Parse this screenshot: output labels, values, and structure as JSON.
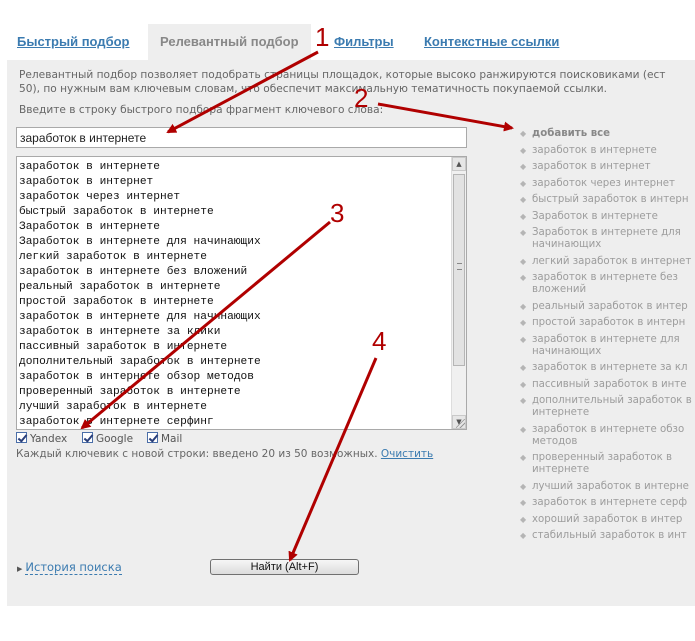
{
  "tabs": [
    {
      "label": "Быстрый подбор",
      "active": false
    },
    {
      "label": "Релевантный подбор",
      "active": true
    },
    {
      "label": "Фильтры",
      "active": false
    },
    {
      "label": "Контекстные ссылки",
      "active": false
    }
  ],
  "description": {
    "line1": "Релевантный подбор позволяет подобрать страницы площадок, которые высоко ранжируются поисковиками (ест",
    "line2": "50), по нужным вам ключевым словам, что обеспечит максимальную тематичность покупаемой ссылки."
  },
  "hint": "Введите в строку быстрого подбора фрагмент ключевого слова:",
  "query": {
    "value": "заработок в интернете"
  },
  "keywords": [
    "заработок в интернете",
    "заработок в интернет",
    "заработок через интернет",
    "быстрый заработок в интернете",
    "Заработок в интернете",
    "Заработок в интернете для начинающих",
    "легкий заработок в интернете",
    "заработок в интернете без вложений",
    "реальный заработок в интернете",
    "простой заработок в интернете",
    "заработок в интернете для начинающих",
    "заработок в интернете за клики",
    "пассивный заработок в интернете",
    "дополнительный заработок в интернете",
    "заработок в интернете обзор методов",
    "проверенный заработок в интернете",
    "лучший заработок в интернете",
    "заработок в интернете серфинг"
  ],
  "engines": [
    {
      "label": "Yandex",
      "checked": true
    },
    {
      "label": "Google",
      "checked": true
    },
    {
      "label": "Mail",
      "checked": true
    }
  ],
  "counter": {
    "text": "Каждый ключевик с новой строки: введено 20 из 50 возможных.",
    "clear_label": "Очистить"
  },
  "history_label": "История поиска",
  "find_button": "Найти (Alt+F)",
  "suggestions": {
    "add_all": "добавить все",
    "items": [
      "заработок в интернете",
      "заработок в интернет",
      "заработок через интернет",
      "быстрый заработок в интерн",
      "Заработок в интернете",
      "Заработок в интернете для начинающих",
      "легкий заработок в интернет",
      "заработок в интернете без вложений",
      "реальный заработок в интер",
      "простой заработок в интерн",
      "заработок в интернете для начинающих",
      "заработок в интернете за кл",
      "пассивный заработок в инте",
      "дополнительный заработок в интернете",
      "заработок в интернете обзо методов",
      "проверенный заработок в интернете",
      "лучший заработок в интерне",
      "заработок в интернете серф",
      "хороший заработок в интер",
      "стабильный заработок в инт"
    ]
  },
  "annotations": {
    "color": "#b00000",
    "labels": [
      "1",
      "2",
      "3",
      "4"
    ]
  }
}
